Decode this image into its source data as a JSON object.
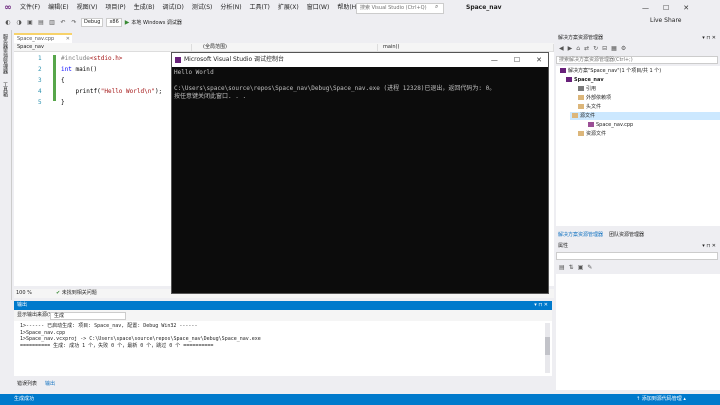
{
  "menubar": {
    "logo": "∞",
    "items": [
      "文件(F)",
      "编辑(E)",
      "视图(V)",
      "项目(P)",
      "生成(B)",
      "调试(D)",
      "测试(S)",
      "分析(N)",
      "工具(T)",
      "扩展(X)",
      "窗口(W)",
      "帮助(H)"
    ],
    "search_placeholder": "搜索 Visual Studio (Ctrl+Q)",
    "search_icon": "⌕",
    "solution_name": "Space_nav",
    "win_min": "—",
    "win_max": "☐",
    "win_close": "✕"
  },
  "toolbar": {
    "config": "Debug",
    "platform": "x86",
    "run_icon": "▶",
    "run_label": "本地 Windows 调试器",
    "live_share": "Live Share"
  },
  "leftstrip": {
    "server_explorer": "服务器资源管理器",
    "toolbox": "工具箱"
  },
  "editor": {
    "tab_label": "Space_nav.cpp",
    "tab_close": "✕",
    "nav_project": "Space_nav",
    "nav_scope": "(全局范围)",
    "nav_member": "main()",
    "lines": [
      {
        "num": "1",
        "pre": "#include",
        "str": "<stdio.h>",
        "post": ""
      },
      {
        "num": "2",
        "kw": "int",
        "post": " main()"
      },
      {
        "num": "3",
        "post": "{"
      },
      {
        "num": "4",
        "pre2": "    printf(",
        "str": "\"Hello World\\n\"",
        "post": ");"
      },
      {
        "num": "5",
        "post": "}"
      }
    ],
    "zoom": "100 %",
    "issues_icon": "✔",
    "issues_text": "未找到相关问题"
  },
  "console": {
    "title": "Microsoft Visual Studio 调试控制台",
    "min": "—",
    "max": "☐",
    "close": "✕",
    "text": "Hello World\n\nC:\\Users\\space\\source\\repos\\Space_nav\\Debug\\Space_nav.exe (进程 12328)已退出，返回代码为: 0。\n按任意键关闭此窗口. . ."
  },
  "output": {
    "title": "输出",
    "header_ctrl": "▾ ⊓ ✕",
    "source_label": "显示输出来源(S):",
    "source_value": "生成",
    "text": "1>------ 已启动生成: 项目: Space_nav, 配置: Debug Win32 ------\n1>Space_nav.cpp\n1>Space_nav.vcxproj -> C:\\Users\\space\\source\\repos\\Space_nav\\Debug\\Space_nav.exe\n========== 生成: 成功 1 个，失败 0 个，最新 0 个，跳过 0 个 =========="
  },
  "bottom_tabs": [
    "错误列表",
    "输出"
  ],
  "solution_explorer": {
    "title": "解决方案资源管理器",
    "title_ctrl": "▾ ⊓ ✕",
    "search_placeholder": "搜索解决方案资源管理器(Ctrl+;)",
    "solution": "解决方案\"Space_nav\"(1 个项目/共 1 个)",
    "project": "Space_nav",
    "references": "引用",
    "external_deps": "外部依赖项",
    "header_files": "头文件",
    "source_files": "源文件",
    "source_file": "Space_nav.cpp",
    "resource_files": "资源文件",
    "tab1": "解决方案资源管理器",
    "tab2": "团队资源管理器"
  },
  "properties": {
    "title": "属性",
    "title_ctrl": "▾ ⊓ ✕"
  },
  "statusbar": {
    "left": "生成成功",
    "right": "↑ 添加到源代码管理 ▴"
  }
}
